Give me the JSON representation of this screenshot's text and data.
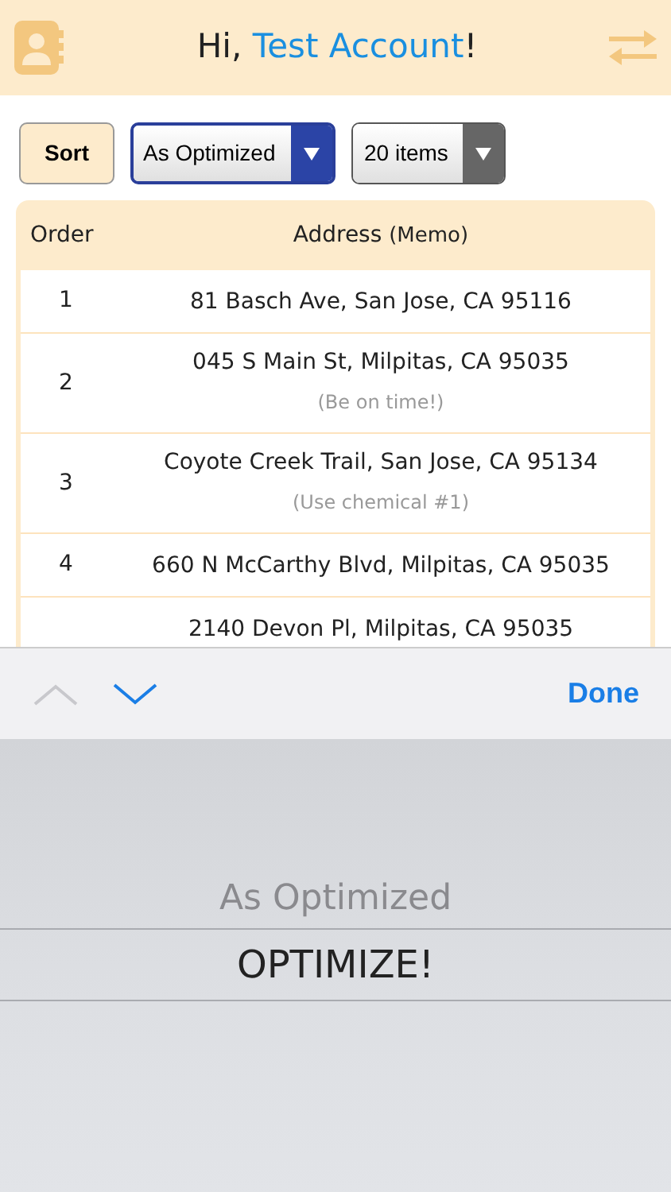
{
  "header": {
    "greeting": "Hi, ",
    "account_name": "Test Account",
    "suffix": "!"
  },
  "controls": {
    "sort_button": "Sort",
    "sort_select": {
      "value": "As Optimized"
    },
    "count_select": {
      "value": "20 items"
    }
  },
  "table": {
    "columns": [
      "Order",
      "Address",
      "(Memo)"
    ],
    "rows": [
      {
        "order": "1",
        "address": "81 Basch Ave, San Jose, CA 95116"
      },
      {
        "order": "2",
        "address": "045 S Main St, Milpitas, CA 95035",
        "memo": "(Be on time!)"
      },
      {
        "order": "3",
        "address": "Coyote Creek Trail, San Jose, CA 95134",
        "memo": "(Use chemical #1)"
      },
      {
        "order": "4",
        "address": "660 N McCarthy Blvd, Milpitas, CA 95035"
      },
      {
        "address": "2140 Devon Pl, Milpitas, CA 95035"
      }
    ]
  },
  "toolbar": {
    "previous": {
      "disabled": true
    },
    "next": {
      "disabled": false
    },
    "done": "Done"
  },
  "picker": {
    "options": [
      {
        "label": "As Optimized",
        "selected": false
      },
      {
        "label": "OPTIMIZE!",
        "selected": true
      }
    ]
  }
}
